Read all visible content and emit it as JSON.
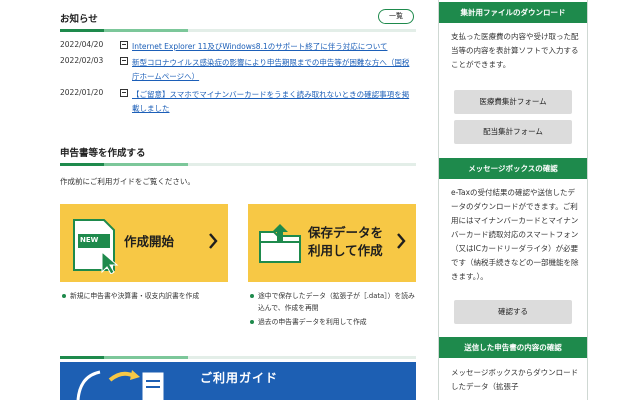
{
  "news": {
    "title": "お知らせ",
    "list_button": "一覧",
    "items": [
      {
        "date": "2022/04/20",
        "text": "Internet Explorer 11及びWindows8.1のサポート終了に伴う対応について"
      },
      {
        "date": "2022/02/03",
        "text": "新型コロナウイルス感染症の影響により申告期限までの申告等が困難な方へ（国税庁ホームページへ）"
      },
      {
        "date": "2022/01/20",
        "text": "【ご留意】スマホでマイナンバーカードをうまく読み取れないときの確認事項を掲載しました"
      }
    ]
  },
  "create": {
    "title": "申告書等を作成する",
    "intro": "作成前にご利用ガイドをご覧ください。",
    "new_card": {
      "badge": "NEW",
      "label": "作成開始"
    },
    "saved_card": {
      "label_line1": "保存データを",
      "label_line2": "利用して作成"
    },
    "new_bullets": [
      "新規に申告書や決算書・収支内訳書を作成"
    ],
    "saved_bullets": [
      "途中で保存したデータ（拡張子が［.data］）を読み込んで、作成を再開",
      "過去の申告書データを利用して作成"
    ]
  },
  "guide": {
    "title": "ご利用ガイド"
  },
  "sidebar": {
    "download": {
      "header": "集計用ファイルのダウンロード",
      "text": "支払った医療費の内容や受け取った配当等の内容を表計算ソフトで入力することができます。",
      "buttons": [
        "医療費集計フォーム",
        "配当集計フォーム"
      ]
    },
    "messagebox": {
      "header": "メッセージボックスの確認",
      "text": "e-Taxの受付結果の確認や送信したデータのダウンロードができます。ご利用にはマイナンバーカードとマイナンバーカード読取対応のスマートフォン（又はICカードリーダライタ）が必要です（納税手続きなどの一部機能を除きます。）。",
      "button": "確認する"
    },
    "sent": {
      "header": "送信した申告書の内容の確認",
      "text": "メッセージボックスからダウンロードしたデータ（拡張子"
    }
  },
  "colors": {
    "brand_green": "#1e8a4c",
    "card_yellow": "#f7c845",
    "guide_blue": "#1d5fb3",
    "link_blue": "#1c5fb8"
  }
}
